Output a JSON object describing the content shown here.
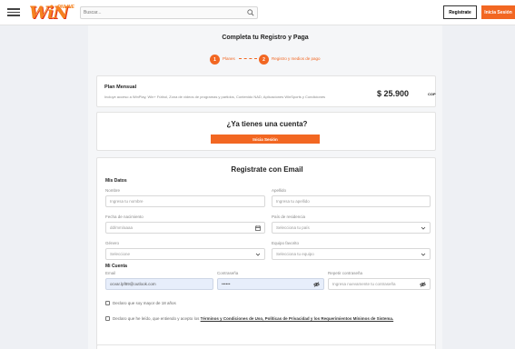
{
  "header": {
    "logo_text": "WiN",
    "logo_sub": "ONLINE",
    "search_placeholder": "Buscar...",
    "register_label": "Registrate",
    "login_label": "Inicia Sesión"
  },
  "page": {
    "title": "Completa tu Registro y Paga",
    "steps": [
      {
        "number": "1",
        "label": "Planes"
      },
      {
        "number": "2",
        "label": "Registro y medios de pago"
      }
    ]
  },
  "plan": {
    "name": "Plan Mensual",
    "description": "Incluye acceso a WinPlay, Win+ Fútbol, Zona de videos de programas y partidos, Contenido NAD, Aplicaciones WinSports y Condiciones",
    "price": "$ 25.900",
    "currency": "COP"
  },
  "account": {
    "title": "¿Ya tienes una cuenta?",
    "login_label": "Inicia Sesión"
  },
  "form": {
    "title": "Registrate con Email",
    "mis_datos": "Mis Datos",
    "mi_cuenta": "Mi Cuenta",
    "fields": {
      "nombre": {
        "label": "Nombre",
        "placeholder": "Ingresa tu nombre"
      },
      "apellido": {
        "label": "Apellido",
        "placeholder": "Ingresa tu apellido"
      },
      "fecha": {
        "label": "Fecha de nacimiento",
        "placeholder": "dd/mm/aaaa"
      },
      "pais": {
        "label": "País de residencia",
        "placeholder": "Selecciona tu país"
      },
      "genero": {
        "label": "Género",
        "placeholder": "Seleccione"
      },
      "equipo": {
        "label": "Equipo favorito",
        "placeholder": "Selecciona tu equipo"
      },
      "email": {
        "label": "Email",
        "value": "ocvar.lpf89@outlook.com"
      },
      "password": {
        "label": "Contraseña",
        "value": "••••••"
      },
      "repeat": {
        "label": "Repetir contraseña",
        "placeholder": "Ingresa nuevamente tu contraseña"
      }
    },
    "check_age": "Declaro que soy mayor de 18 años",
    "check_terms_prefix": "Declaro que he leído, que entiendo y acepto los",
    "check_terms_link": "Términos y Condiciones de Uso, Políticas de Privacidad y los Requerimientos Mínimos de Sistema."
  },
  "colors": {
    "accent": "#f26722",
    "filled_field": "#e7eefb"
  }
}
